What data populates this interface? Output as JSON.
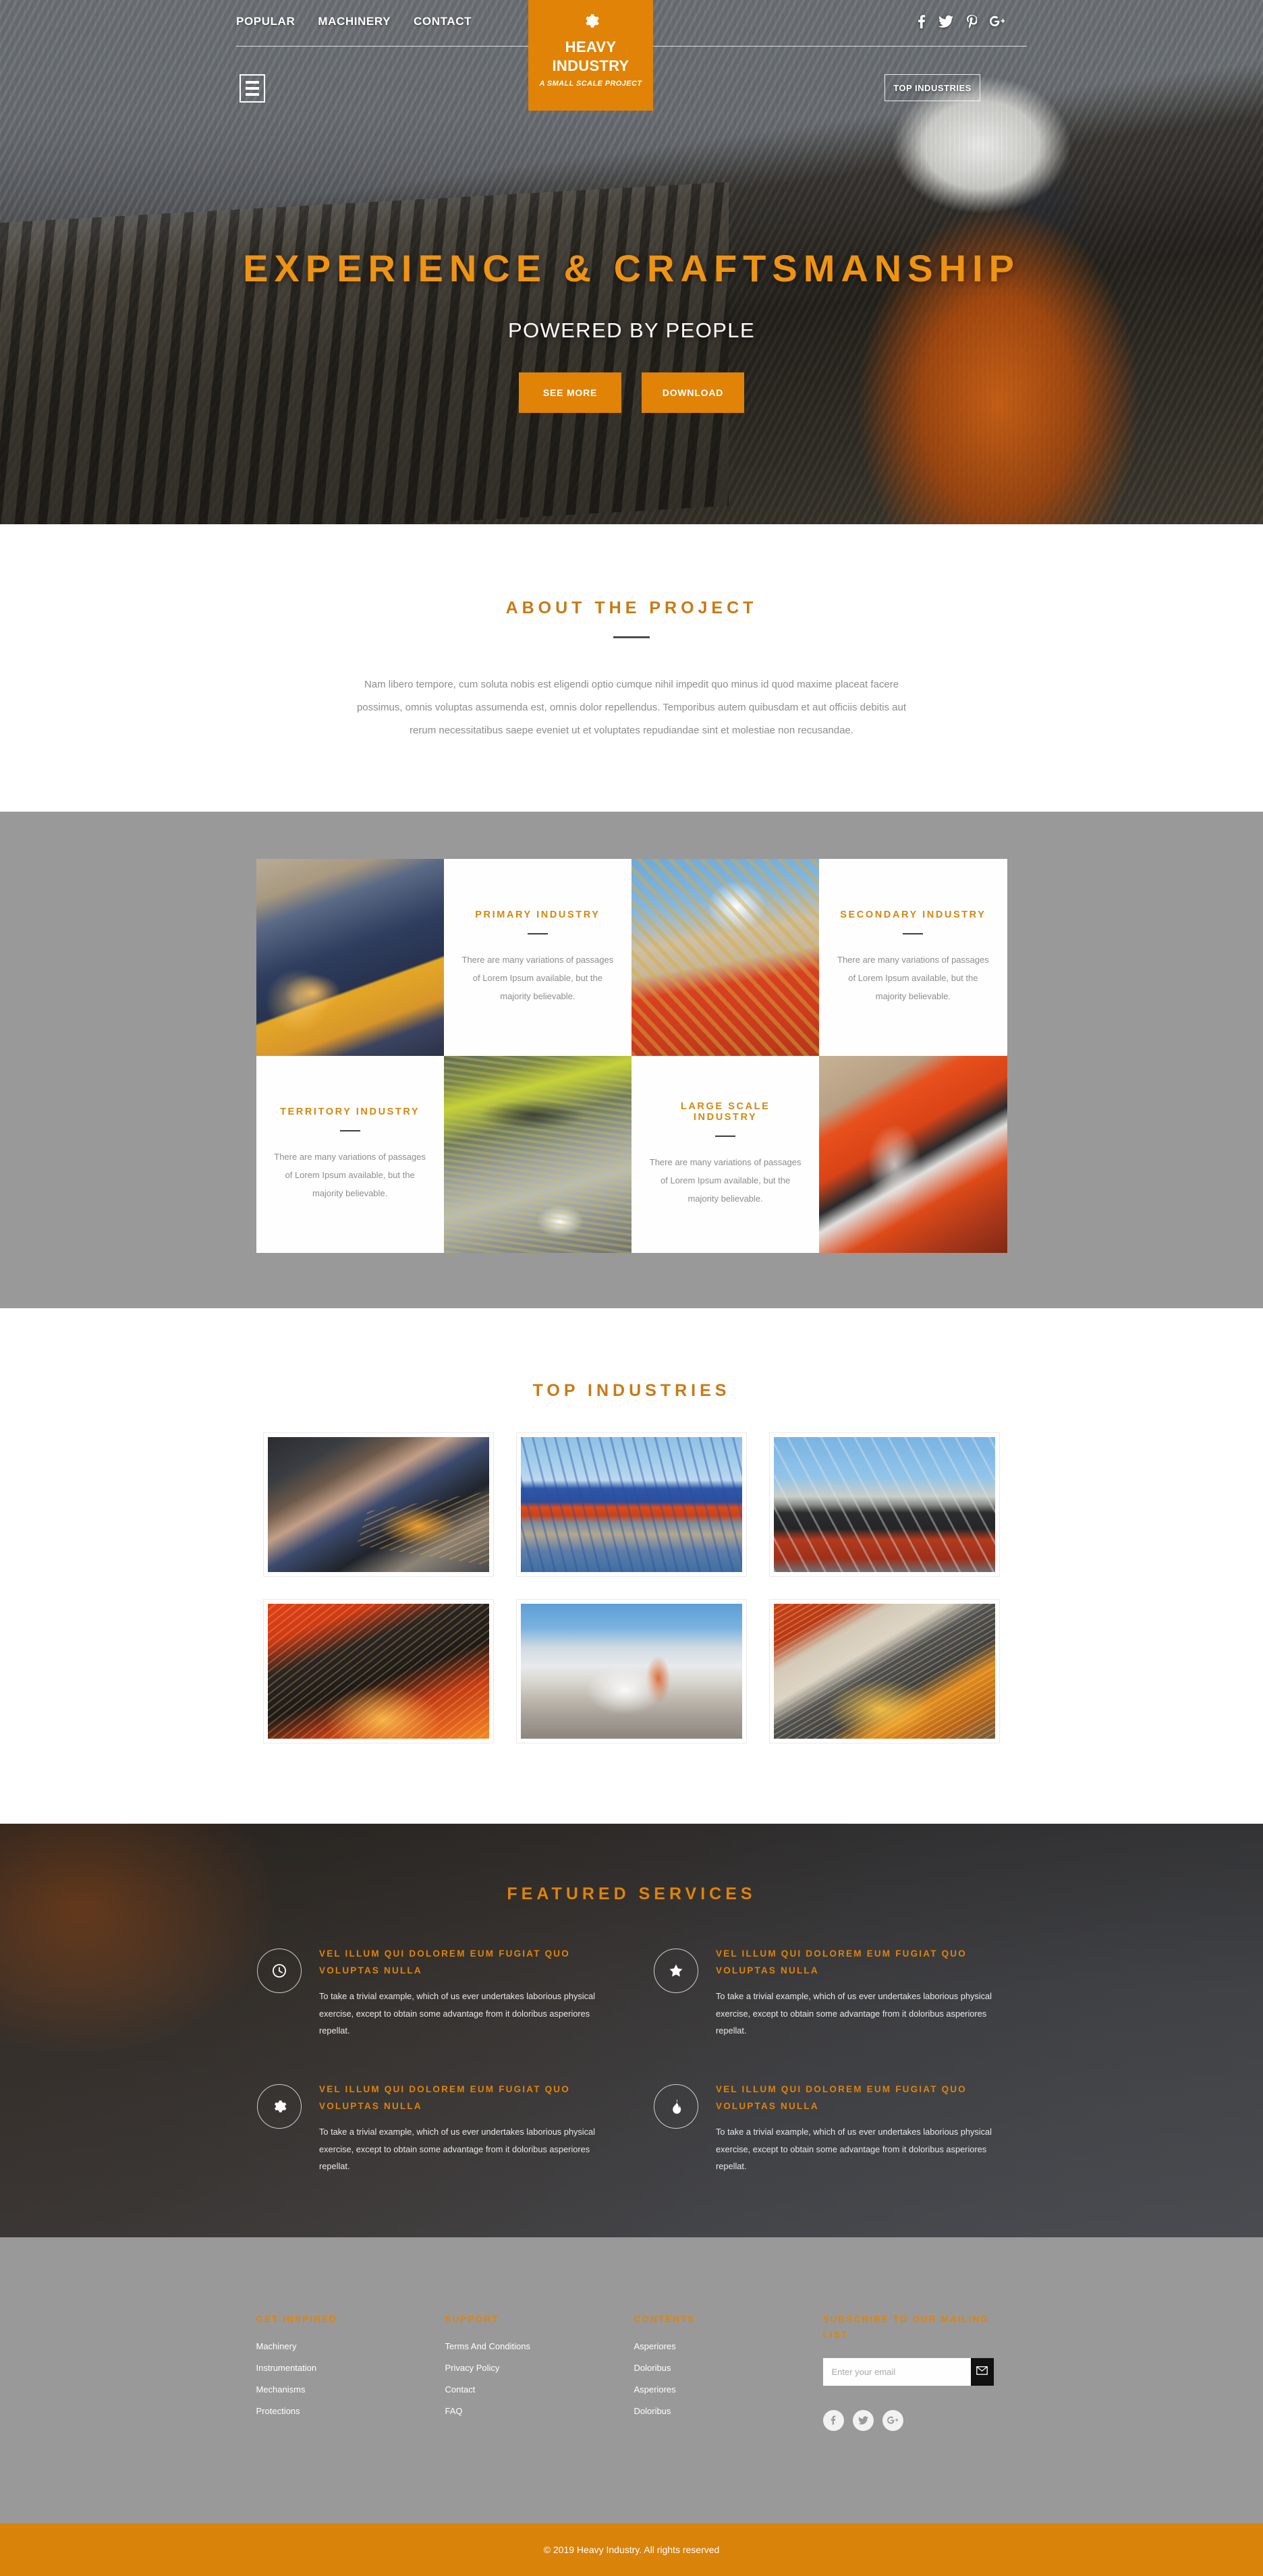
{
  "brand": {
    "line1": "HEAVY",
    "line2": "INDUSTRY",
    "tagline": "A SMALL SCALE PROJECT",
    "gear_icon": "gear-icon"
  },
  "colors": {
    "accent": "#e08307",
    "accent_title": "#c87a14",
    "hero_title": "#ef9412",
    "band_gray": "#999999",
    "copy_bar": "#d9830b",
    "dark_section": "#413d3b"
  },
  "header": {
    "nav": [
      {
        "label": "POPULAR"
      },
      {
        "label": "MACHINERY"
      },
      {
        "label": "CONTACT"
      }
    ],
    "social": [
      {
        "name": "facebook-icon"
      },
      {
        "name": "twitter-icon"
      },
      {
        "name": "pinterest-icon"
      },
      {
        "name": "googleplus-icon"
      }
    ],
    "menu_toggle": "hamburger-icon",
    "top_industries_button": "TOP INDUSTRIES"
  },
  "hero": {
    "title": "EXPERIENCE & CRAFTSMANSHIP",
    "subtitle": "POWERED BY PEOPLE",
    "primary_button": "SEE MORE",
    "secondary_button": "DOWNLOAD"
  },
  "about": {
    "title": "ABOUT THE PROJECT",
    "body": "Nam libero tempore, cum soluta nobis est eligendi optio cumque nihil impedit quo minus id quod maxime placeat facere possimus, omnis voluptas assumenda est, omnis dolor repellendus. Temporibus autem quibusdam et aut officiis debitis aut rerum necessitatibus saepe eveniet ut et voluptates repudiandae sint et molestiae non recusandae."
  },
  "industries": [
    {
      "title": "PRIMARY INDUSTRY",
      "body": "There are many variations of passages of Lorem Ipsum available, but the majority believable.",
      "image_name": "welder-blue-mask-photo"
    },
    {
      "title": "SECONDARY INDUSTRY",
      "body": "There are many variations of passages of Lorem Ipsum available, but the majority believable.",
      "image_name": "crane-worker-chain-photo"
    },
    {
      "title": "TERRITORY INDUSTRY",
      "body": "There are many variations of passages of Lorem Ipsum available, but the majority believable.",
      "image_name": "pipe-welding-photo"
    },
    {
      "title": "LARGE SCALE INDUSTRY",
      "body": "There are many variations of passages of Lorem Ipsum available, but the majority believable.",
      "image_name": "orange-clamp-photo"
    }
  ],
  "top_industries": {
    "title": "TOP INDUSTRIES",
    "gallery": [
      {
        "image_name": "angle-grinder-worker-photo"
      },
      {
        "image_name": "port-container-cranes-photo"
      },
      {
        "image_name": "shipyard-crane-vessel-photo"
      },
      {
        "image_name": "red-lit-welder-photo"
      },
      {
        "image_name": "concrete-saw-dust-photo"
      },
      {
        "image_name": "cutting-sparks-photo"
      }
    ]
  },
  "featured": {
    "title": "FEATURED SERVICES",
    "items": [
      {
        "icon": "clock-icon",
        "title": "VEL ILLUM QUI DOLOREM EUM FUGIAT QUO VOLUPTAS NULLA",
        "body": "To take a trivial example, which of us ever undertakes laborious physical exercise, except to obtain some advantage from it doloribus asperiores repellat."
      },
      {
        "icon": "star-icon",
        "title": "VEL ILLUM QUI DOLOREM EUM FUGIAT QUO VOLUPTAS NULLA",
        "body": "To take a trivial example, which of us ever undertakes laborious physical exercise, except to obtain some advantage from it doloribus asperiores repellat."
      },
      {
        "icon": "gear-icon",
        "title": "VEL ILLUM QUI DOLOREM EUM FUGIAT QUO VOLUPTAS NULLA",
        "body": "To take a trivial example, which of us ever undertakes laborious physical exercise, except to obtain some advantage from it doloribus asperiores repellat."
      },
      {
        "icon": "flame-icon",
        "title": "VEL ILLUM QUI DOLOREM EUM FUGIAT QUO VOLUPTAS NULLA",
        "body": "To take a trivial example, which of us ever undertakes laborious physical exercise, except to obtain some advantage from it doloribus asperiores repellat."
      }
    ]
  },
  "footer": {
    "columns": [
      {
        "heading": "GET INSPIRED",
        "links": [
          "Machinery",
          "Instrumentation",
          "Mechanisms",
          "Protections"
        ]
      },
      {
        "heading": "SUPPORT",
        "links": [
          "Terms And Conditions",
          "Privacy Policy",
          "Contact",
          "FAQ"
        ]
      },
      {
        "heading": "CONTENTS",
        "links": [
          "Asperiores",
          "Doloribus",
          "Asperiores",
          "Doloribus"
        ]
      }
    ],
    "subscribe": {
      "heading": "SUBSCRIBE TO OUR MAILING LIST",
      "placeholder": "Enter your email",
      "value": "",
      "button_icon": "envelope-icon"
    },
    "social": [
      {
        "name": "facebook-icon"
      },
      {
        "name": "twitter-icon"
      },
      {
        "name": "googleplus-icon"
      }
    ],
    "copyright": "© 2019 Heavy Industry. All rights reserved"
  }
}
